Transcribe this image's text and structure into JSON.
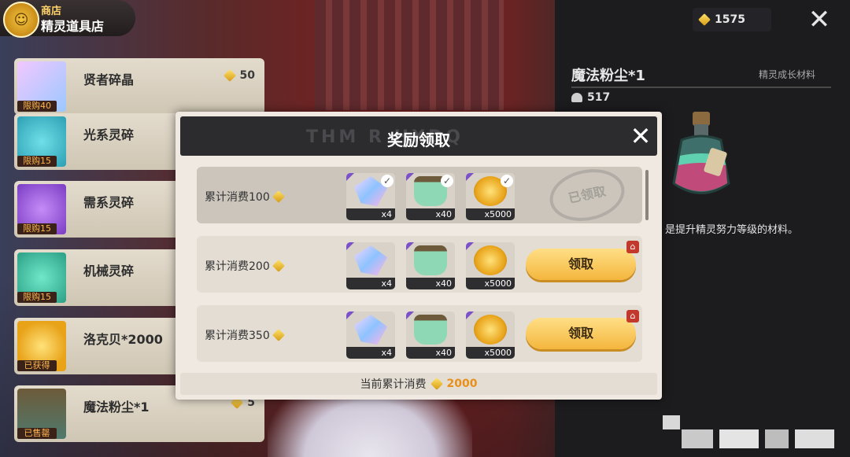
{
  "shop": {
    "subtitle": "商店",
    "title": "精灵道具店"
  },
  "currency": {
    "value": "1575",
    "icon": "gem-icon"
  },
  "shop_items": [
    {
      "name": "贤者碎晶",
      "price": "50",
      "tag": "限购40",
      "icon": "crystal-icon"
    },
    {
      "name": "光系灵碎",
      "price": "",
      "tag": "限购15",
      "icon": "light-shard-icon"
    },
    {
      "name": "需系灵碎",
      "price": "",
      "tag": "限购15",
      "icon": "thunder-shard-icon"
    },
    {
      "name": "机械灵碎",
      "price": "",
      "tag": "限购15",
      "icon": "mech-shard-icon"
    },
    {
      "name": "洛克贝*2000",
      "price": "",
      "tag": "已获得",
      "icon": "coin-icon"
    },
    {
      "name": "魔法粉尘*1",
      "price": "5",
      "tag": "已售罄",
      "icon": "dust-bottle-icon"
    }
  ],
  "detail": {
    "name": "魔法粉尘*1",
    "category": "精灵成长材料",
    "owned": "517",
    "description": "是提升精灵努力等级的材料。"
  },
  "modal": {
    "title": "奖励领取",
    "header_deco": "THM R  HXDQ",
    "footer_label": "当前累计消费",
    "footer_value": "2000",
    "claim_label": "领取",
    "claimed_label": "已领取"
  },
  "reward_rows": [
    {
      "label": "累计消费100",
      "claimed": true,
      "items": [
        {
          "type": "crystal",
          "qty": "x4"
        },
        {
          "type": "bottle",
          "qty": "x40"
        },
        {
          "type": "coin",
          "qty": "x5000"
        }
      ]
    },
    {
      "label": "累计消费200",
      "claimed": false,
      "items": [
        {
          "type": "crystal",
          "qty": "x4"
        },
        {
          "type": "bottle",
          "qty": "x40"
        },
        {
          "type": "coin",
          "qty": "x5000"
        }
      ]
    },
    {
      "label": "累计消费350",
      "claimed": false,
      "items": [
        {
          "type": "crystal",
          "qty": "x4"
        },
        {
          "type": "bottle",
          "qty": "x40"
        },
        {
          "type": "coin",
          "qty": "x5000"
        }
      ]
    }
  ],
  "colors": {
    "accent": "#f4b63e",
    "footer_value": "#e8901a",
    "panel_dark": "#1c1c1f"
  }
}
